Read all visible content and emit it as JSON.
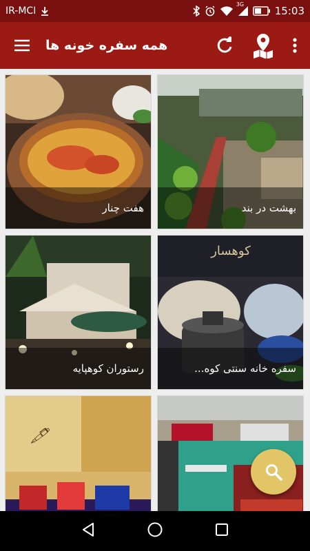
{
  "status_bar": {
    "carrier": "IR-MCI",
    "network_type": "3G",
    "time": "15:03",
    "icons": [
      "download-icon",
      "bluetooth-icon",
      "alarm-icon",
      "wifi-icon",
      "signal-icon",
      "battery-icon"
    ]
  },
  "app_bar": {
    "title": "همه سفره خونه ها",
    "icons": [
      "menu-icon",
      "refresh-icon",
      "map-pin-icon",
      "more-vert-icon"
    ]
  },
  "cards": [
    {
      "title": "بهشت در بند"
    },
    {
      "title": "هفت چنار"
    },
    {
      "title": "سفره خانه سنتی کوه..."
    },
    {
      "title": "رستوران کوهپایه"
    },
    {
      "title": ""
    },
    {
      "title": ""
    }
  ],
  "card_images": {
    "card_2_sign": "کوهسار"
  },
  "fab": {
    "icon": "search-icon"
  },
  "nav_bar": {
    "icons": [
      "back-icon",
      "home-icon",
      "recents-icon"
    ]
  },
  "colors": {
    "status_bar": "#7a0f0f",
    "app_bar": "#9b1b14",
    "fab": "#e2c567",
    "background": "#eeeeee"
  }
}
